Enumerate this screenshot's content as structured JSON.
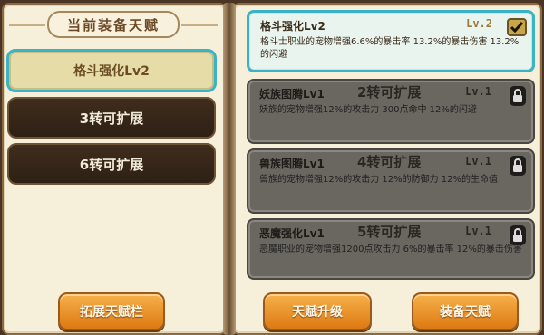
{
  "left_panel": {
    "title": "当前装备天赋",
    "slots": [
      {
        "label": "格斗强化Lv2",
        "state": "equipped"
      },
      {
        "label": "3转可扩展",
        "state": "locked"
      },
      {
        "label": "6转可扩展",
        "state": "locked"
      }
    ],
    "expand_button": "拓展天赋栏"
  },
  "talents": [
    {
      "name": "格斗强化Lv2",
      "level": "Lv.2",
      "unlock": "",
      "desc": "格斗士职业的宠物增强6.6%的暴击率 13.2%的暴击伤害 13.2%的闪避",
      "icon": "check-icon"
    },
    {
      "name": "妖族图腾Lv1",
      "level": "Lv.1",
      "unlock": "2转可扩展",
      "desc": "妖族的宠物增强12%的攻击力 300点命中 12%的闪避",
      "icon": "lock-icon"
    },
    {
      "name": "兽族图腾Lv1",
      "level": "Lv.1",
      "unlock": "4转可扩展",
      "desc": "兽族的宠物增强12%的攻击力 12%的防御力 12%的生命值",
      "icon": "lock-icon"
    },
    {
      "name": "恶魔强化Lv1",
      "level": "Lv.1",
      "unlock": "5转可扩展",
      "desc": "恶魔职业的宠物增强1200点攻击力 6%的暴击率 12%的暴击伤害",
      "icon": "lock-icon"
    }
  ],
  "buttons": {
    "upgrade": "天赋升级",
    "equip": "装备天赋"
  },
  "colors": {
    "accent_selected": "#3ab3c4",
    "button_orange": "#e8941f",
    "locked_slot": "#33251a",
    "locked_card": "#6a6660"
  }
}
